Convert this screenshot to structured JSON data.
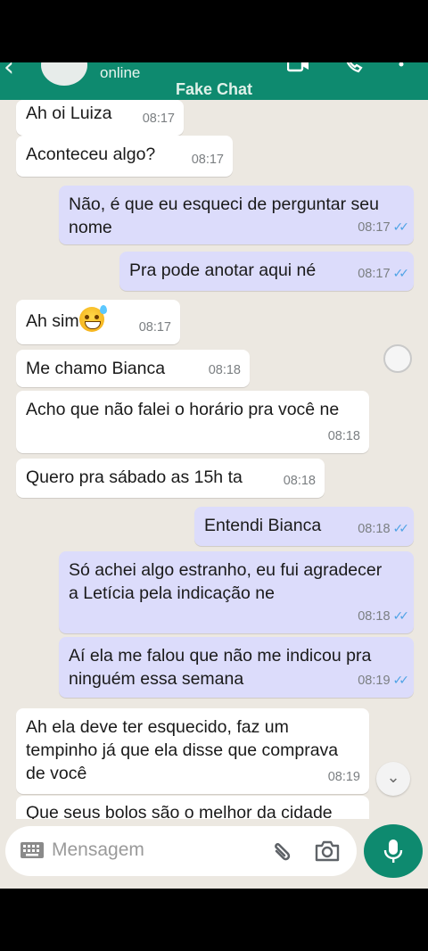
{
  "header": {
    "status": "online",
    "title": "Fake Chat"
  },
  "messages": [
    {
      "text": "Ah oi Luiza",
      "time": "08:17",
      "dir": "in"
    },
    {
      "text": "Aconteceu algo?",
      "time": "08:17",
      "dir": "in"
    },
    {
      "text": "Não, é que eu esqueci de perguntar seu nome",
      "time": "08:17",
      "dir": "out",
      "read": true
    },
    {
      "text": "Pra pode anotar aqui né",
      "time": "08:17",
      "dir": "out",
      "read": true
    },
    {
      "text": "Ah sim",
      "time": "08:17",
      "dir": "in",
      "emoji": "sweat-smile-emoji"
    },
    {
      "text": "Me chamo Bianca",
      "time": "08:18",
      "dir": "in"
    },
    {
      "text": "Acho que não falei o horário pra você ne",
      "time": "08:18",
      "dir": "in"
    },
    {
      "text": "Quero pra sábado as 15h ta",
      "time": "08:18",
      "dir": "in"
    },
    {
      "text": "Entendi Bianca",
      "time": "08:18",
      "dir": "out",
      "read": true
    },
    {
      "text": "Só achei algo estranho, eu fui agradecer a Letícia pela indicação ne",
      "time": "08:18",
      "dir": "out",
      "read": true
    },
    {
      "text": "Aí ela me falou que não me indicou pra ninguém essa semana",
      "time": "08:19",
      "dir": "out",
      "read": true
    },
    {
      "text": "Ah ela deve ter esquecido, faz um tempinho já que ela disse que comprava de você",
      "time": "08:19",
      "dir": "in"
    }
  ],
  "partial_message": "Que seus bolos são o melhor da cidade",
  "composer": {
    "placeholder": "Mensagem"
  },
  "colors": {
    "header": "#0e8a6f",
    "chat_bg": "#ece8e1",
    "outgoing_bubble": "#dcdcfb",
    "incoming_bubble": "#ffffff",
    "read_tick": "#4fa3e6"
  }
}
